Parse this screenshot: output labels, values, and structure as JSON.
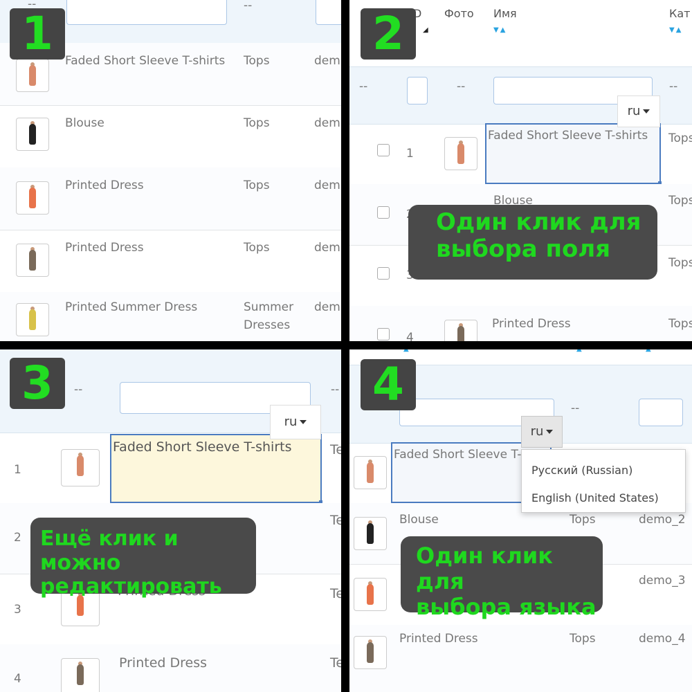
{
  "panels": [
    {
      "number": "1"
    },
    {
      "number": "2"
    },
    {
      "number": "3"
    },
    {
      "number": "4"
    }
  ],
  "panel1": {
    "filter": {
      "dash1": "--",
      "dash2": "--"
    },
    "rows": [
      {
        "name": "Faded Short Sleeve T-shirts",
        "category": "Tops",
        "ref": "dem"
      },
      {
        "name": "Blouse",
        "category": "Tops",
        "ref": "dem"
      },
      {
        "name": "Printed Dress",
        "category": "Tops",
        "ref": "dem"
      },
      {
        "name": "Printed Dress",
        "category": "Tops",
        "ref": "dem"
      },
      {
        "name": "Printed Summer Dress",
        "category": "Summer",
        "category2": "Dresses",
        "ref": "dem"
      }
    ]
  },
  "panel2": {
    "headers": {
      "id": "D",
      "photo": "Фото",
      "name": "Имя",
      "cat": "Кат"
    },
    "filter": {
      "dash1": "--",
      "dash2": "--",
      "dash3": "--"
    },
    "lang": "ru",
    "rows": [
      {
        "id": "1",
        "name": "Faded Short Sleeve T-shirts",
        "cat": "Tops"
      },
      {
        "id": "2",
        "name": "Blouse",
        "cat": "Tops"
      },
      {
        "id": "3",
        "name": "",
        "cat": "Tops"
      },
      {
        "id": "4",
        "name": "Printed Dress",
        "cat": "Tops"
      }
    ],
    "callout": {
      "line1": "Один клик для",
      "line2": "выбора поля"
    }
  },
  "panel3": {
    "filter": {
      "dash1": "--",
      "dash2": "--"
    },
    "lang": "ru",
    "rows": [
      {
        "id": "1",
        "name": "Faded Short Sleeve T-shirts",
        "cat": "Te"
      },
      {
        "id": "2",
        "name": "",
        "cat": "Te"
      },
      {
        "id": "3",
        "name": "Printed Dress",
        "cat": "Te"
      },
      {
        "id": "4",
        "name": "Printed Dress",
        "cat": "Te"
      }
    ],
    "callout": {
      "line1": "Ещё клик и можно",
      "line2": "редактировать"
    }
  },
  "panel4": {
    "filter": {
      "dash": "--"
    },
    "lang": "ru",
    "menu": [
      "Русский (Russian)",
      "English (United States)"
    ],
    "rows": [
      {
        "name": "Faded Short Sleeve T-s",
        "cat": "",
        "ref": ""
      },
      {
        "name": "Blouse",
        "cat": "Tops",
        "ref": "demo_2"
      },
      {
        "name": "",
        "cat": "",
        "ref": "demo_3"
      },
      {
        "name": "Printed Dress",
        "cat": "Tops",
        "ref": "demo_4"
      }
    ],
    "callout": {
      "line1": "Один клик для",
      "line2": "выбора языка"
    }
  }
}
